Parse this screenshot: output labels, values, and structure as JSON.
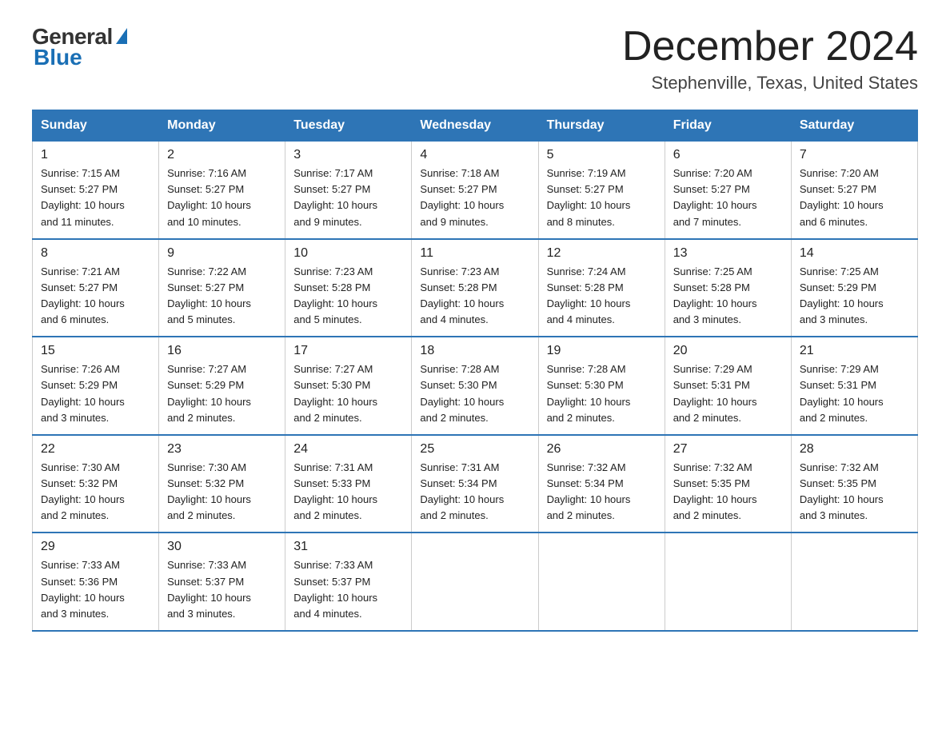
{
  "header": {
    "logo_general": "General",
    "logo_blue": "Blue",
    "month_title": "December 2024",
    "location": "Stephenville, Texas, United States"
  },
  "days_of_week": [
    "Sunday",
    "Monday",
    "Tuesday",
    "Wednesday",
    "Thursday",
    "Friday",
    "Saturday"
  ],
  "weeks": [
    [
      {
        "day": "1",
        "info": "Sunrise: 7:15 AM\nSunset: 5:27 PM\nDaylight: 10 hours\nand 11 minutes."
      },
      {
        "day": "2",
        "info": "Sunrise: 7:16 AM\nSunset: 5:27 PM\nDaylight: 10 hours\nand 10 minutes."
      },
      {
        "day": "3",
        "info": "Sunrise: 7:17 AM\nSunset: 5:27 PM\nDaylight: 10 hours\nand 9 minutes."
      },
      {
        "day": "4",
        "info": "Sunrise: 7:18 AM\nSunset: 5:27 PM\nDaylight: 10 hours\nand 9 minutes."
      },
      {
        "day": "5",
        "info": "Sunrise: 7:19 AM\nSunset: 5:27 PM\nDaylight: 10 hours\nand 8 minutes."
      },
      {
        "day": "6",
        "info": "Sunrise: 7:20 AM\nSunset: 5:27 PM\nDaylight: 10 hours\nand 7 minutes."
      },
      {
        "day": "7",
        "info": "Sunrise: 7:20 AM\nSunset: 5:27 PM\nDaylight: 10 hours\nand 6 minutes."
      }
    ],
    [
      {
        "day": "8",
        "info": "Sunrise: 7:21 AM\nSunset: 5:27 PM\nDaylight: 10 hours\nand 6 minutes."
      },
      {
        "day": "9",
        "info": "Sunrise: 7:22 AM\nSunset: 5:27 PM\nDaylight: 10 hours\nand 5 minutes."
      },
      {
        "day": "10",
        "info": "Sunrise: 7:23 AM\nSunset: 5:28 PM\nDaylight: 10 hours\nand 5 minutes."
      },
      {
        "day": "11",
        "info": "Sunrise: 7:23 AM\nSunset: 5:28 PM\nDaylight: 10 hours\nand 4 minutes."
      },
      {
        "day": "12",
        "info": "Sunrise: 7:24 AM\nSunset: 5:28 PM\nDaylight: 10 hours\nand 4 minutes."
      },
      {
        "day": "13",
        "info": "Sunrise: 7:25 AM\nSunset: 5:28 PM\nDaylight: 10 hours\nand 3 minutes."
      },
      {
        "day": "14",
        "info": "Sunrise: 7:25 AM\nSunset: 5:29 PM\nDaylight: 10 hours\nand 3 minutes."
      }
    ],
    [
      {
        "day": "15",
        "info": "Sunrise: 7:26 AM\nSunset: 5:29 PM\nDaylight: 10 hours\nand 3 minutes."
      },
      {
        "day": "16",
        "info": "Sunrise: 7:27 AM\nSunset: 5:29 PM\nDaylight: 10 hours\nand 2 minutes."
      },
      {
        "day": "17",
        "info": "Sunrise: 7:27 AM\nSunset: 5:30 PM\nDaylight: 10 hours\nand 2 minutes."
      },
      {
        "day": "18",
        "info": "Sunrise: 7:28 AM\nSunset: 5:30 PM\nDaylight: 10 hours\nand 2 minutes."
      },
      {
        "day": "19",
        "info": "Sunrise: 7:28 AM\nSunset: 5:30 PM\nDaylight: 10 hours\nand 2 minutes."
      },
      {
        "day": "20",
        "info": "Sunrise: 7:29 AM\nSunset: 5:31 PM\nDaylight: 10 hours\nand 2 minutes."
      },
      {
        "day": "21",
        "info": "Sunrise: 7:29 AM\nSunset: 5:31 PM\nDaylight: 10 hours\nand 2 minutes."
      }
    ],
    [
      {
        "day": "22",
        "info": "Sunrise: 7:30 AM\nSunset: 5:32 PM\nDaylight: 10 hours\nand 2 minutes."
      },
      {
        "day": "23",
        "info": "Sunrise: 7:30 AM\nSunset: 5:32 PM\nDaylight: 10 hours\nand 2 minutes."
      },
      {
        "day": "24",
        "info": "Sunrise: 7:31 AM\nSunset: 5:33 PM\nDaylight: 10 hours\nand 2 minutes."
      },
      {
        "day": "25",
        "info": "Sunrise: 7:31 AM\nSunset: 5:34 PM\nDaylight: 10 hours\nand 2 minutes."
      },
      {
        "day": "26",
        "info": "Sunrise: 7:32 AM\nSunset: 5:34 PM\nDaylight: 10 hours\nand 2 minutes."
      },
      {
        "day": "27",
        "info": "Sunrise: 7:32 AM\nSunset: 5:35 PM\nDaylight: 10 hours\nand 2 minutes."
      },
      {
        "day": "28",
        "info": "Sunrise: 7:32 AM\nSunset: 5:35 PM\nDaylight: 10 hours\nand 3 minutes."
      }
    ],
    [
      {
        "day": "29",
        "info": "Sunrise: 7:33 AM\nSunset: 5:36 PM\nDaylight: 10 hours\nand 3 minutes."
      },
      {
        "day": "30",
        "info": "Sunrise: 7:33 AM\nSunset: 5:37 PM\nDaylight: 10 hours\nand 3 minutes."
      },
      {
        "day": "31",
        "info": "Sunrise: 7:33 AM\nSunset: 5:37 PM\nDaylight: 10 hours\nand 4 minutes."
      },
      {
        "day": "",
        "info": ""
      },
      {
        "day": "",
        "info": ""
      },
      {
        "day": "",
        "info": ""
      },
      {
        "day": "",
        "info": ""
      }
    ]
  ]
}
